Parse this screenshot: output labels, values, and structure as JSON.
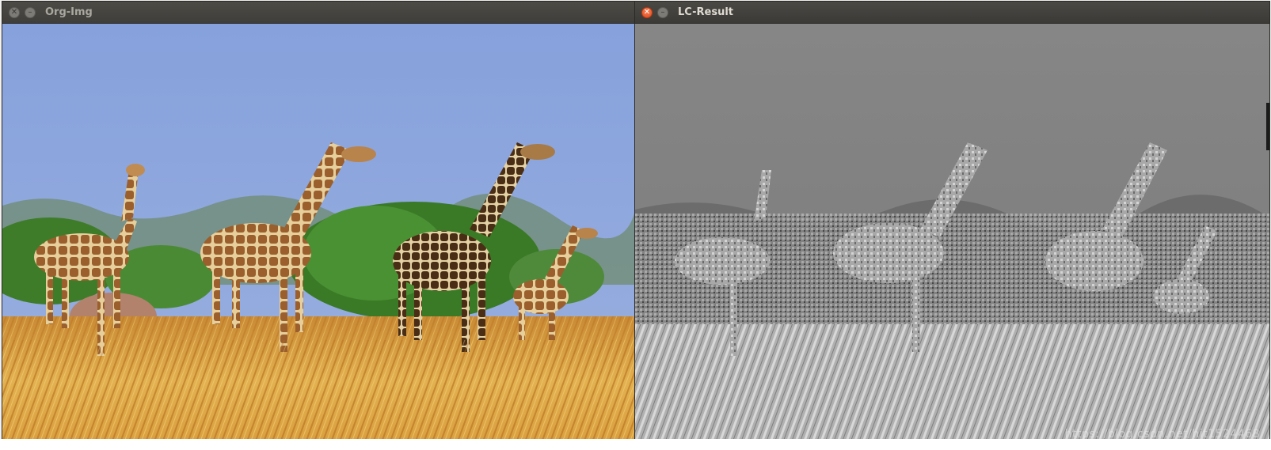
{
  "windows": {
    "left": {
      "title": "Org-Img",
      "close_icon": "close-icon",
      "minimize_icon": "minimize-icon",
      "image_content": "color photograph of four giraffes in tall golden grass"
    },
    "right": {
      "title": "LC-Result",
      "close_icon": "close-icon",
      "minimize_icon": "minimize-icon",
      "image_content": "grayscale LC saliency map of the same giraffes",
      "watermark": "https://blog.csdn.net/hit1524468"
    }
  },
  "colors": {
    "titlebar": "#3f3e3a",
    "close_active": "#e0461a",
    "title_text": "#dfdbd2",
    "sky": "#8fa8e0",
    "grass": "#d9a441"
  }
}
